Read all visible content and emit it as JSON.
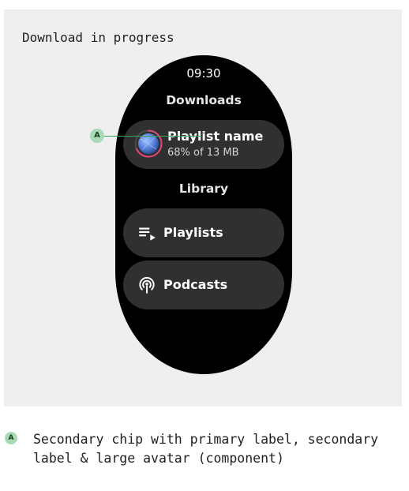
{
  "panel": {
    "title": "Download in progress"
  },
  "watch": {
    "time": "09:30",
    "downloads_title": "Downloads",
    "download_chip": {
      "primary_label": "Playlist name",
      "secondary_label": "68% of 13 MB",
      "progress": 0.68,
      "avatar_icon": "album-art-avatar"
    },
    "library_title": "Library",
    "library_items": [
      {
        "label": "Playlists",
        "icon": "playlist-icon"
      },
      {
        "label": "Podcasts",
        "icon": "podcast-icon"
      }
    ]
  },
  "annotation": {
    "marker": "A",
    "description": "Secondary chip with primary label, secondary label & large avatar (component)"
  },
  "colors": {
    "panel_bg": "#efefef",
    "watch_bg": "#000000",
    "chip_bg": "#303030",
    "progress_ring": "#e0487a",
    "marker_bg": "#a8dab5",
    "callout_line": "#3ea35a"
  }
}
